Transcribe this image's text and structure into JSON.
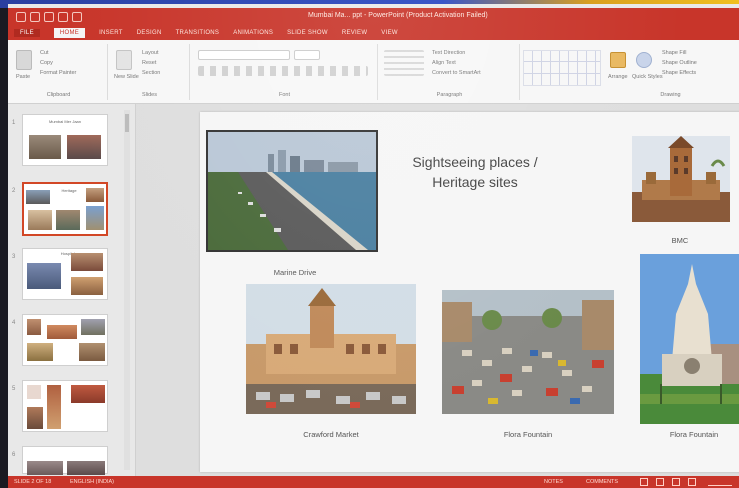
{
  "window": {
    "title": "Mumbai Ma... ppt - PowerPoint (Product Activation Failed)"
  },
  "ribbon_tabs": [
    "FILE",
    "HOME",
    "INSERT",
    "DESIGN",
    "TRANSITIONS",
    "ANIMATIONS",
    "SLIDE SHOW",
    "REVIEW",
    "VIEW"
  ],
  "ribbon": {
    "clipboard": {
      "paste": "Paste",
      "cut": "Cut",
      "copy": "Copy",
      "format_painter": "Format Painter",
      "label": "Clipboard"
    },
    "slides": {
      "new_slide": "New Slide",
      "layout": "Layout",
      "reset": "Reset",
      "section": "Section",
      "label": "Slides"
    },
    "font": {
      "label": "Font"
    },
    "paragraph": {
      "text_direction": "Text Direction",
      "align_text": "Align Text",
      "convert_smartart": "Convert to SmartArt",
      "label": "Paragraph"
    },
    "drawing": {
      "arrange": "Arrange",
      "quick_styles": "Quick Styles",
      "shape_fill": "Shape Fill",
      "shape_outline": "Shape Outline",
      "shape_effects": "Shape Effects",
      "label": "Drawing"
    }
  },
  "thumbnails": [
    {
      "num": "1",
      "title": "Mumbai Mer Jaan"
    },
    {
      "num": "2",
      "title": "Heritage"
    },
    {
      "num": "3",
      "title": "Hospital"
    },
    {
      "num": "4",
      "title": ""
    },
    {
      "num": "5",
      "title": ""
    },
    {
      "num": "6",
      "title": ""
    }
  ],
  "slide": {
    "title_line1": "Sightseeing places /",
    "title_line2": "Heritage sites",
    "images": [
      {
        "caption": "Marine Drive",
        "icon": "marine-drive-photo"
      },
      {
        "caption": "BMC",
        "icon": "bmc-building-photo"
      },
      {
        "caption": "Crawford Market",
        "icon": "crawford-market-photo"
      },
      {
        "caption": "Flora Fountain",
        "icon": "street-traffic-photo"
      },
      {
        "caption": "Flora Fountain",
        "icon": "flora-fountain-photo"
      }
    ]
  },
  "statusbar": {
    "slide_counter": "SLIDE 2 OF 18",
    "language": "ENGLISH (INDIA)",
    "notes": "NOTES",
    "comments": "COMMENTS"
  },
  "colors": {
    "accent": "#c8352a",
    "selected_thumb": "#d24726"
  }
}
